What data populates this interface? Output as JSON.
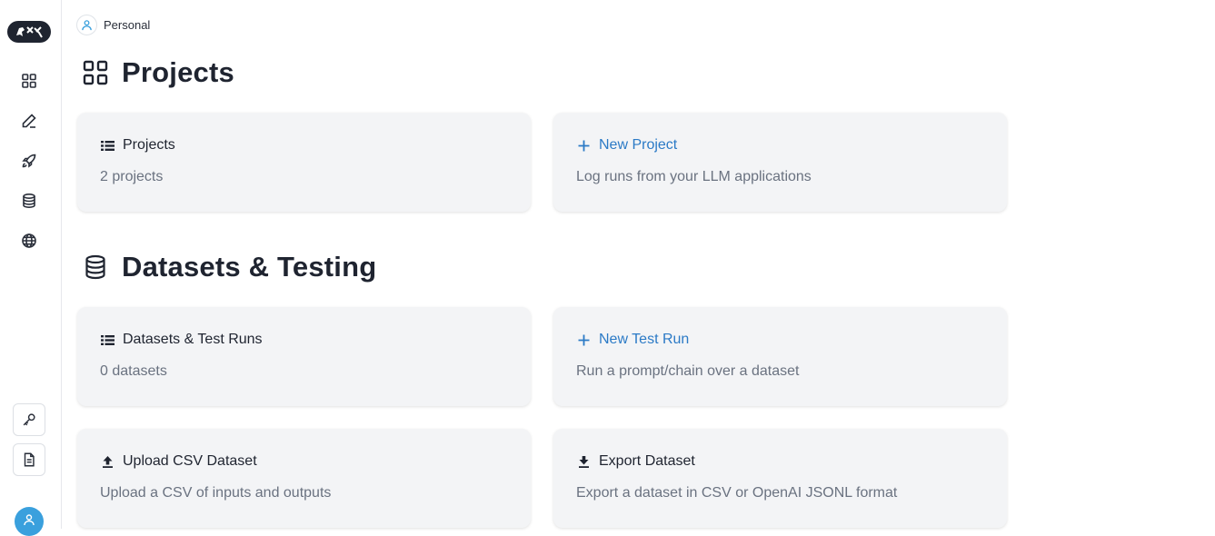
{
  "sidebar": {
    "logo_icon": "parrot-tools-logo",
    "nav": [
      "grid-icon",
      "pen-icon",
      "rocket-icon",
      "database-icon",
      "globe-icon"
    ],
    "bottom": [
      "key-icon",
      "document-icon"
    ],
    "avatar_color": "#3aa0dd"
  },
  "header": {
    "org_label": "Personal"
  },
  "sections": {
    "projects": {
      "title": "Projects",
      "list_card": {
        "title": "Projects",
        "desc": "2 projects"
      },
      "new_card": {
        "title": "New Project",
        "desc": "Log runs from your LLM applications"
      }
    },
    "datasets": {
      "title": "Datasets & Testing",
      "list_card": {
        "title": "Datasets & Test Runs",
        "desc": "0 datasets"
      },
      "new_card": {
        "title": "New Test Run",
        "desc": "Run a prompt/chain over a dataset"
      },
      "upload_card": {
        "title": "Upload CSV Dataset",
        "desc": "Upload a CSV of inputs and outputs"
      },
      "export_card": {
        "title": "Export Dataset",
        "desc": "Export a dataset in CSV or OpenAI JSONL format"
      }
    }
  },
  "colors": {
    "accent": "#2b7ac6",
    "card_bg": "#f3f4f6",
    "text": "#1f2430",
    "muted": "#6a7280"
  }
}
